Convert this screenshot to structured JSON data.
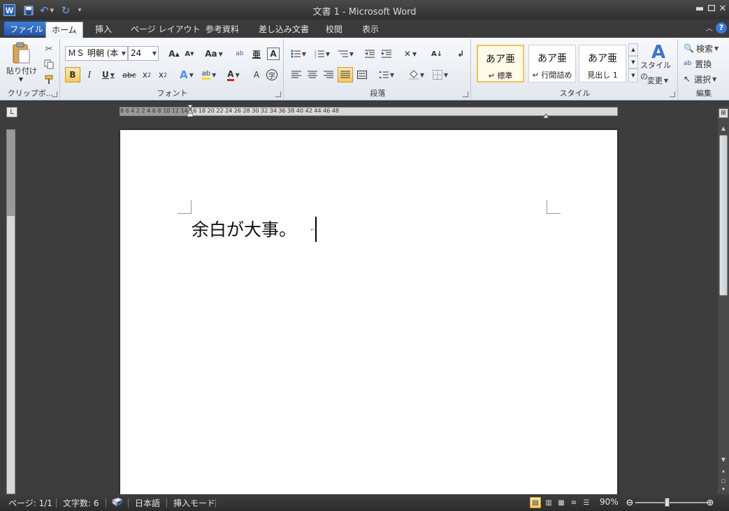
{
  "window": {
    "title": "文書 1 - Microsoft Word",
    "app_icon_letter": "W",
    "minimize_glyph": "▬",
    "maximize_glyph": "▫",
    "close_glyph": "✕"
  },
  "tabs": [
    {
      "label": "ファイル"
    },
    {
      "label": "ホーム"
    },
    {
      "label": "挿入"
    },
    {
      "label": "ページ レイアウト"
    },
    {
      "label": "参考資料"
    },
    {
      "label": "差し込み文書"
    },
    {
      "label": "校閲"
    },
    {
      "label": "表示"
    }
  ],
  "ribbon": {
    "clipboard": {
      "label": "クリップボ...",
      "paste_label": "貼り付け"
    },
    "font": {
      "label": "フォント",
      "font_name": "ＭＳ 明朝 (本",
      "font_size": "24"
    },
    "paragraph": {
      "label": "段落"
    },
    "styles": {
      "label": "スタイル",
      "items": [
        {
          "sample": "あア亜",
          "name": "↵ 標準"
        },
        {
          "sample": "あア亜",
          "name": "↵ 行間詰め"
        },
        {
          "sample": "あア亜",
          "name": "見出し 1"
        }
      ],
      "change_label_1": "スタイルの",
      "change_label_2": "変更"
    },
    "editing": {
      "label": "編集",
      "find": "検索",
      "replace": "置換",
      "select": "選択"
    }
  },
  "ruler": {
    "h_labels": "8  6  4  2     2  4  6  8  10  12  14  16  18  20  22  24  26  28  30  32  34  36  38  40  42  44  46  48",
    "corner": "L"
  },
  "document": {
    "text": "余白が大事。"
  },
  "status": {
    "page": "ページ: 1/1",
    "words": "文字数: 6",
    "language": "日本語",
    "mode": "挿入モード",
    "zoom": "90%"
  }
}
